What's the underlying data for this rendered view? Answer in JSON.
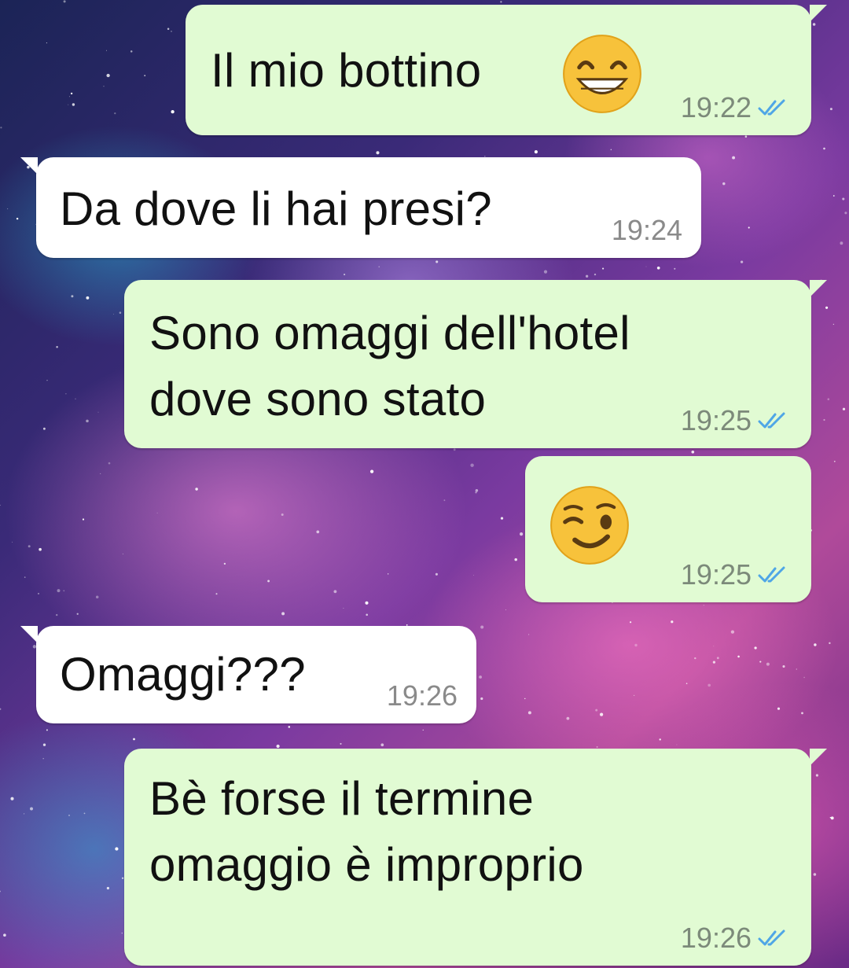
{
  "chat": {
    "accent_tick_color": "#4fa6e6",
    "outgoing_bubble_color": "#e1fbd3",
    "incoming_bubble_color": "#ffffff",
    "messages": [
      {
        "direction": "out",
        "text": "Il mio bottino",
        "emoji": "grinning-face-with-smiling-eyes",
        "time": "19:22",
        "status": "read"
      },
      {
        "direction": "in",
        "text": "Da dove li hai presi?",
        "time": "19:24"
      },
      {
        "direction": "out",
        "text": "Sono omaggi dell'hotel\ndove sono stato",
        "time": "19:25",
        "status": "read"
      },
      {
        "direction": "out",
        "text": "",
        "emoji": "winking-face",
        "time": "19:25",
        "status": "read"
      },
      {
        "direction": "in",
        "text": "Omaggi???",
        "time": "19:26"
      },
      {
        "direction": "out",
        "text": "Bè forse il termine\nomaggio è improprio",
        "time": "19:26",
        "status": "read"
      }
    ]
  }
}
